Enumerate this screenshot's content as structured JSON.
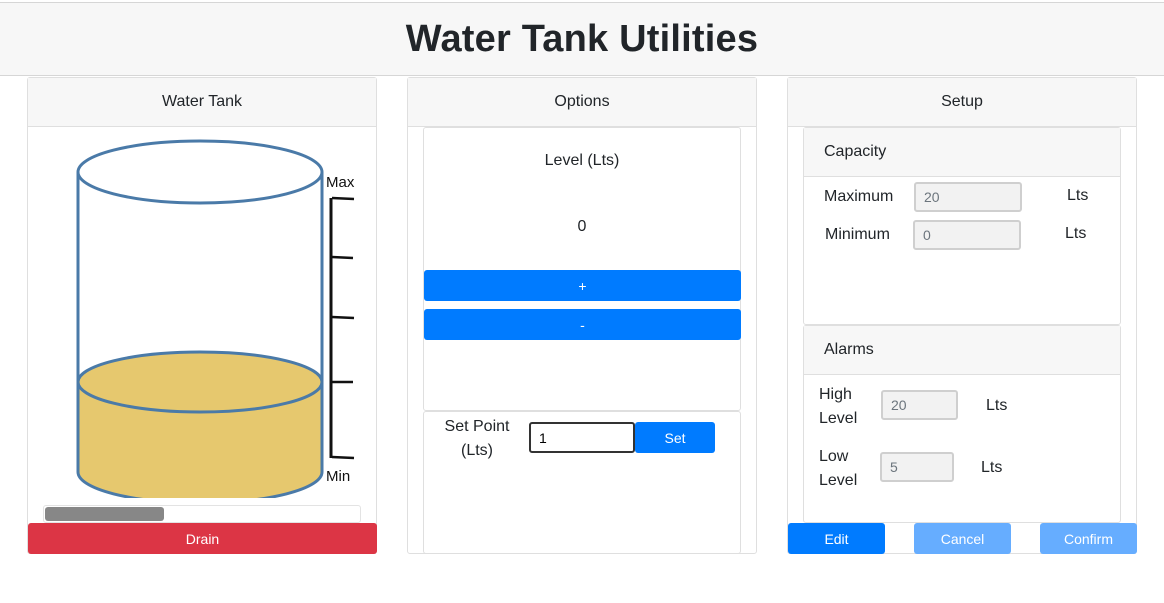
{
  "app": {
    "title": "Water Tank Utilities"
  },
  "tank_panel": {
    "title": "Water Tank",
    "scale_max_label": "Max",
    "scale_min_label": "Min",
    "fill_fraction": 0.28,
    "water_color": "#e6c86e",
    "outline_color": "#4a7aa8",
    "drain_slider_fraction": 0.38,
    "drain_label": "Drain"
  },
  "options_panel": {
    "title": "Options",
    "level_label": "Level (Lts)",
    "level_value": "0",
    "increase_label": "+",
    "decrease_label": "-",
    "set_point_label": "Set Point (Lts)",
    "set_point_value": "1",
    "set_label": "Set"
  },
  "setup_panel": {
    "title": "Setup",
    "capacity": {
      "title": "Capacity",
      "maximum_label": "Maximum",
      "maximum_value": "20",
      "minimum_label": "Minimum",
      "minimum_value": "0",
      "unit": "Lts"
    },
    "alarms": {
      "title": "Alarms",
      "high_level_label": "High Level",
      "high_level_value": "20",
      "low_level_label": "Low Level",
      "low_level_value": "5",
      "unit": "Lts"
    },
    "edit_label": "Edit",
    "cancel_label": "Cancel",
    "confirm_label": "Confirm"
  },
  "colors": {
    "primary": "#007bff",
    "primary_disabled": "#66adff",
    "danger": "#dc3545"
  }
}
